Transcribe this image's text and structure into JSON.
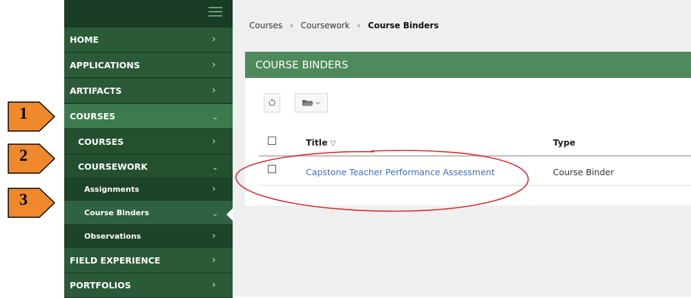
{
  "sidebar": {
    "items": [
      {
        "label": "HOME",
        "chevron": "right"
      },
      {
        "label": "APPLICATIONS",
        "chevron": "right"
      },
      {
        "label": "ARTIFACTS",
        "chevron": "right"
      },
      {
        "label": "COURSES",
        "chevron": "down",
        "expanded": true
      },
      {
        "label": "COURSES",
        "chevron": "right"
      },
      {
        "label": "COURSEWORK",
        "chevron": "down",
        "expanded": true
      },
      {
        "label": "Assignments",
        "chevron": "right"
      },
      {
        "label": "Course Binders",
        "chevron": "down",
        "selected": true
      },
      {
        "label": "Observations",
        "chevron": "right"
      },
      {
        "label": "FIELD EXPERIENCE",
        "chevron": "right"
      },
      {
        "label": "PORTFOLIOS",
        "chevron": "right"
      }
    ]
  },
  "steps": [
    "1",
    "2",
    "3"
  ],
  "breadcrumb": {
    "items": [
      "Courses",
      "Coursework"
    ],
    "current": "Course Binders"
  },
  "panel": {
    "title": "COURSE BINDERS"
  },
  "toolbar": {
    "icons": [
      "refresh-icon",
      "folder-icon"
    ]
  },
  "table": {
    "columns": [
      "Title",
      "Type"
    ],
    "rows": [
      {
        "title": "Capstone Teacher Performance Assessment",
        "type": "Course Binder"
      }
    ]
  },
  "colors": {
    "sidebar_bg": "#1f4a2d",
    "panel_header": "#4e8a5b",
    "link": "#3a6fc4",
    "step_arrow": "#f0892c",
    "annotation": "#d9262a"
  }
}
